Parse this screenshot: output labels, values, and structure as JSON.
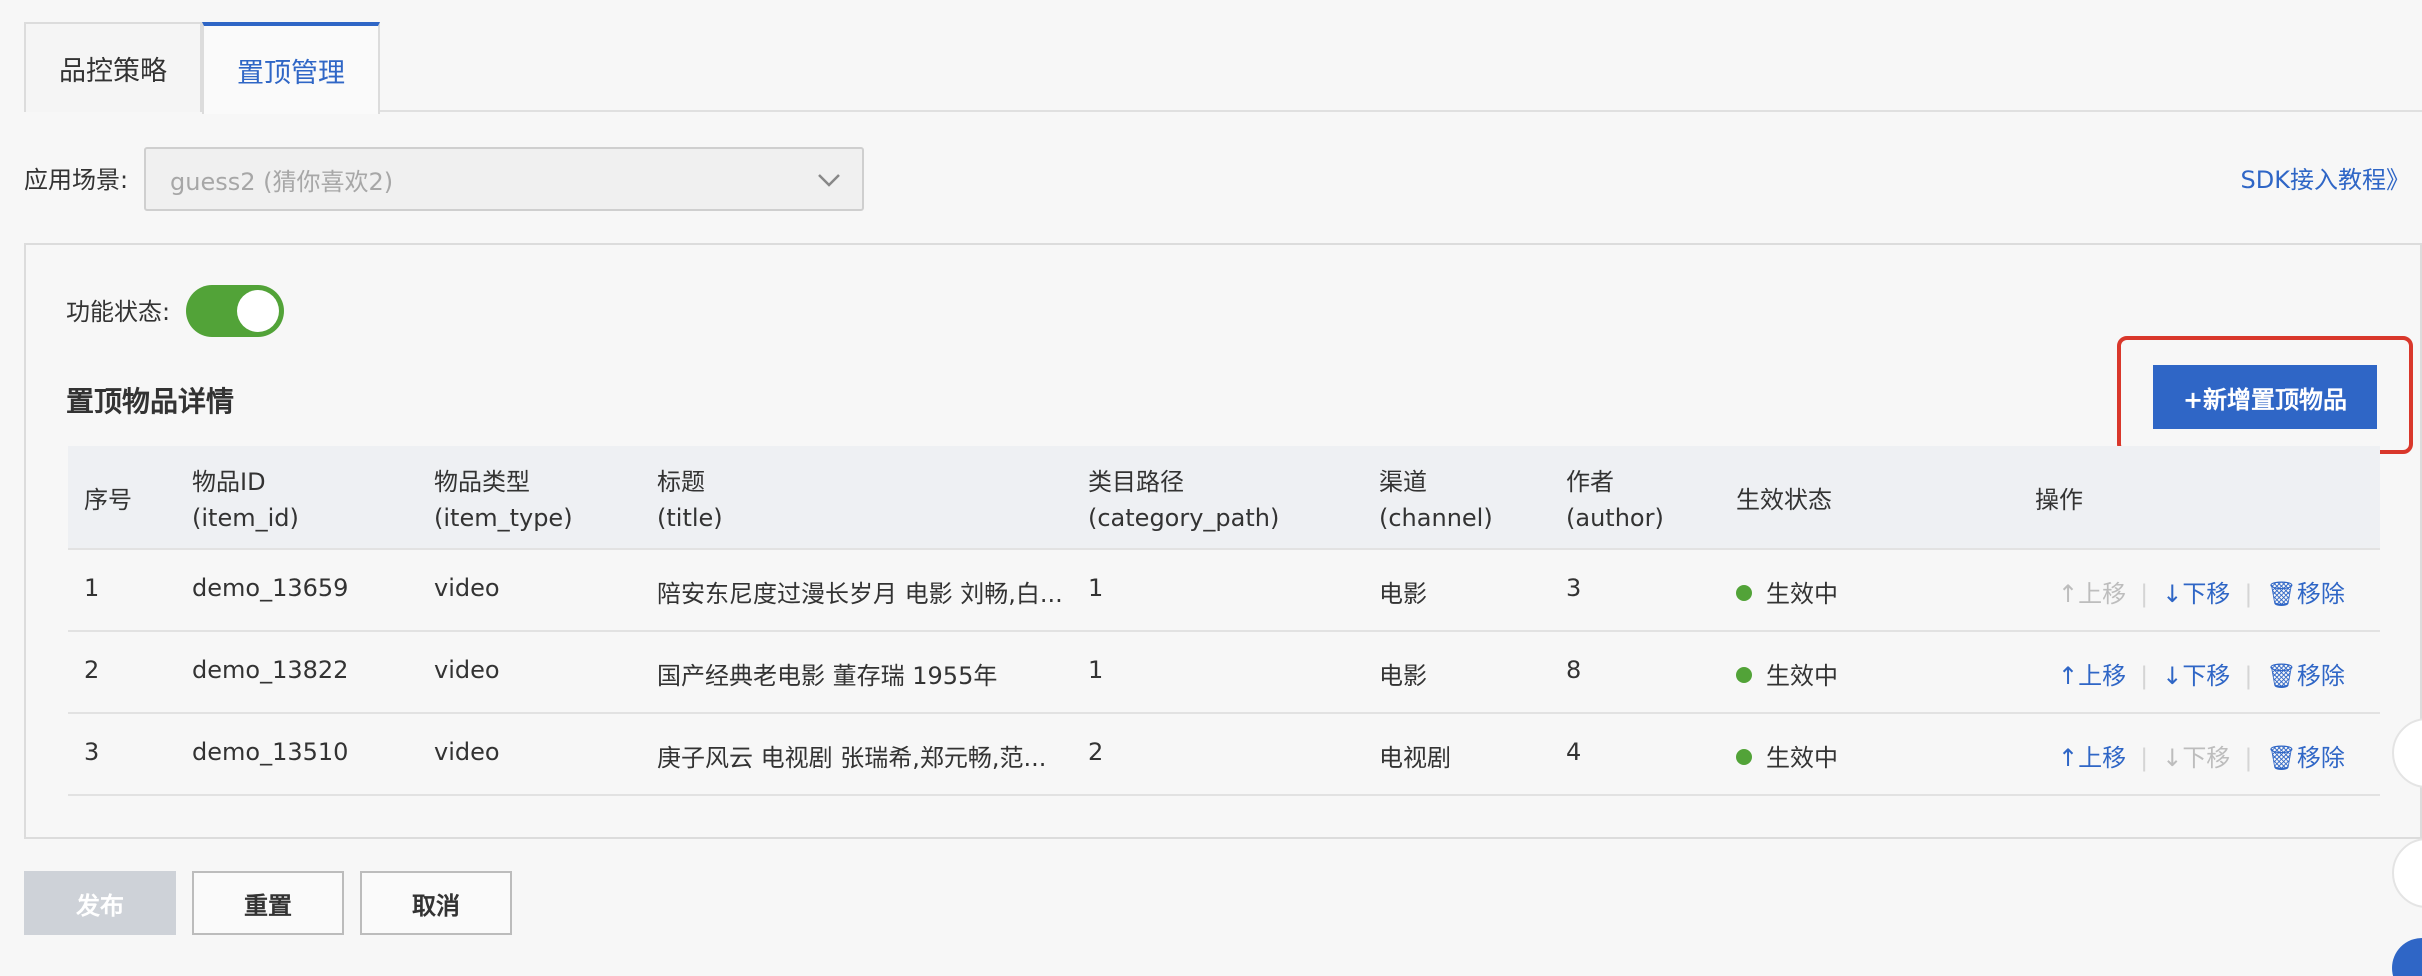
{
  "tabs": [
    {
      "label": "品控策略"
    },
    {
      "label": "置顶管理"
    }
  ],
  "scene": {
    "label": "应用场景:",
    "value": "guess2 (猜你喜欢2)"
  },
  "sdk_link": "SDK接入教程》",
  "panel": {
    "status_label": "功能状态:",
    "toggle_on": true,
    "section_title": "置顶物品详情",
    "add_button": "+新增置顶物品"
  },
  "table": {
    "headers": [
      {
        "line1": "序号",
        "line2": ""
      },
      {
        "line1": "物品ID",
        "line2": "(item_id)"
      },
      {
        "line1": "物品类型",
        "line2": "(item_type)"
      },
      {
        "line1": "标题",
        "line2": "(title)"
      },
      {
        "line1": "类目路径",
        "line2": "(category_path)"
      },
      {
        "line1": "渠道",
        "line2": "(channel)"
      },
      {
        "line1": "作者",
        "line2": "(author)"
      },
      {
        "line1": "生效状态",
        "line2": ""
      },
      {
        "line1": "操作",
        "line2": ""
      }
    ],
    "rows": [
      {
        "index": "1",
        "item_id": "demo_13659",
        "item_type": "video",
        "title": "陪安东尼度过漫长岁月 电影 刘畅,白...",
        "category_path": "1",
        "channel": "电影",
        "author": "3",
        "status": "生效中",
        "up": "上移",
        "down": "下移",
        "remove": "移除"
      },
      {
        "index": "2",
        "item_id": "demo_13822",
        "item_type": "video",
        "title": "国产经典老电影 董存瑞 1955年",
        "category_path": "1",
        "channel": "电影",
        "author": "8",
        "status": "生效中",
        "up": "上移",
        "down": "下移",
        "remove": "移除"
      },
      {
        "index": "3",
        "item_id": "demo_13510",
        "item_type": "video",
        "title": "庚子风云 电视剧 张瑞希,郑元畅,范...",
        "category_path": "2",
        "channel": "电视剧",
        "author": "4",
        "status": "生效中",
        "up": "上移",
        "down": "下移",
        "remove": "移除"
      }
    ]
  },
  "footer": {
    "publish": "发布",
    "reset": "重置",
    "cancel": "取消"
  },
  "colors": {
    "accent": "#2f66c6",
    "success": "#52a338",
    "highlight": "#d9372b"
  }
}
